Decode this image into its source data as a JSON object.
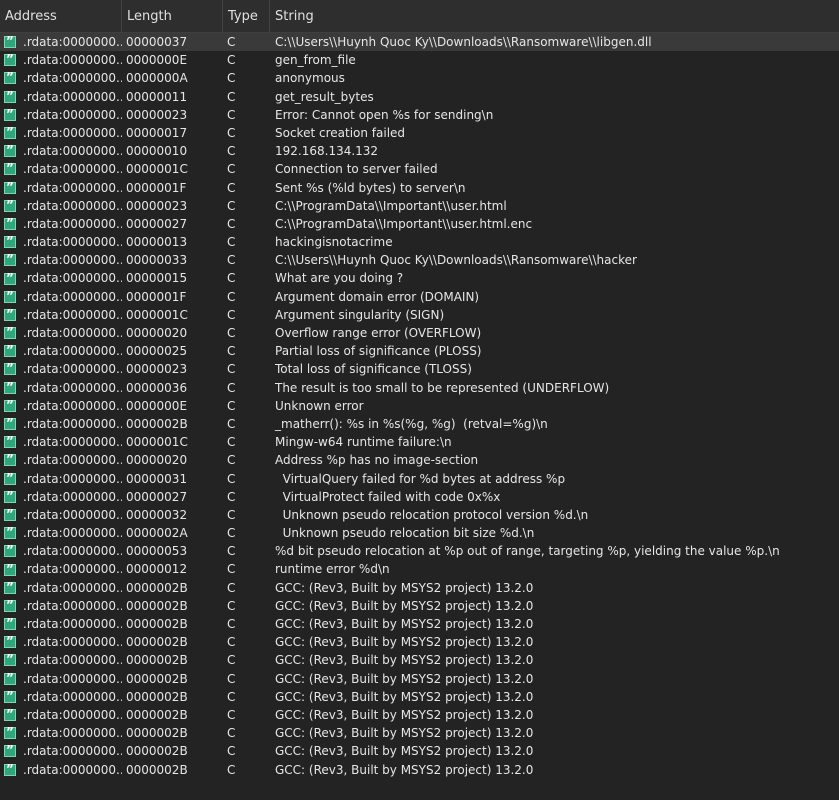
{
  "columns": {
    "address": "Address",
    "length": "Length",
    "type": "Type",
    "string": "String"
  },
  "rows": [
    {
      "address": ".rdata:0000000...",
      "length": "00000037",
      "type": "C",
      "string": "C:\\\\Users\\\\Huynh Quoc Ky\\\\Downloads\\\\Ransomware\\\\libgen.dll"
    },
    {
      "address": ".rdata:0000000...",
      "length": "0000000E",
      "type": "C",
      "string": "gen_from_file"
    },
    {
      "address": ".rdata:0000000...",
      "length": "0000000A",
      "type": "C",
      "string": "anonymous"
    },
    {
      "address": ".rdata:0000000...",
      "length": "00000011",
      "type": "C",
      "string": "get_result_bytes"
    },
    {
      "address": ".rdata:0000000...",
      "length": "00000023",
      "type": "C",
      "string": "Error: Cannot open %s for sending\\n"
    },
    {
      "address": ".rdata:0000000...",
      "length": "00000017",
      "type": "C",
      "string": "Socket creation failed"
    },
    {
      "address": ".rdata:0000000...",
      "length": "00000010",
      "type": "C",
      "string": "192.168.134.132"
    },
    {
      "address": ".rdata:0000000...",
      "length": "0000001C",
      "type": "C",
      "string": "Connection to server failed"
    },
    {
      "address": ".rdata:0000000...",
      "length": "0000001F",
      "type": "C",
      "string": "Sent %s (%ld bytes) to server\\n"
    },
    {
      "address": ".rdata:0000000...",
      "length": "00000023",
      "type": "C",
      "string": "C:\\\\ProgramData\\\\Important\\\\user.html"
    },
    {
      "address": ".rdata:0000000...",
      "length": "00000027",
      "type": "C",
      "string": "C:\\\\ProgramData\\\\Important\\\\user.html.enc"
    },
    {
      "address": ".rdata:0000000...",
      "length": "00000013",
      "type": "C",
      "string": "hackingisnotacrime"
    },
    {
      "address": ".rdata:0000000...",
      "length": "00000033",
      "type": "C",
      "string": "C:\\\\Users\\\\Huynh Quoc Ky\\\\Downloads\\\\Ransomware\\\\hacker"
    },
    {
      "address": ".rdata:0000000...",
      "length": "00000015",
      "type": "C",
      "string": "What are you doing ?"
    },
    {
      "address": ".rdata:0000000...",
      "length": "0000001F",
      "type": "C",
      "string": "Argument domain error (DOMAIN)"
    },
    {
      "address": ".rdata:0000000...",
      "length": "0000001C",
      "type": "C",
      "string": "Argument singularity (SIGN)"
    },
    {
      "address": ".rdata:0000000...",
      "length": "00000020",
      "type": "C",
      "string": "Overflow range error (OVERFLOW)"
    },
    {
      "address": ".rdata:0000000...",
      "length": "00000025",
      "type": "C",
      "string": "Partial loss of significance (PLOSS)"
    },
    {
      "address": ".rdata:0000000...",
      "length": "00000023",
      "type": "C",
      "string": "Total loss of significance (TLOSS)"
    },
    {
      "address": ".rdata:0000000...",
      "length": "00000036",
      "type": "C",
      "string": "The result is too small to be represented (UNDERFLOW)"
    },
    {
      "address": ".rdata:0000000...",
      "length": "0000000E",
      "type": "C",
      "string": "Unknown error"
    },
    {
      "address": ".rdata:0000000...",
      "length": "0000002B",
      "type": "C",
      "string": "_matherr(): %s in %s(%g, %g)  (retval=%g)\\n"
    },
    {
      "address": ".rdata:0000000...",
      "length": "0000001C",
      "type": "C",
      "string": "Mingw-w64 runtime failure:\\n"
    },
    {
      "address": ".rdata:0000000...",
      "length": "00000020",
      "type": "C",
      "string": "Address %p has no image-section"
    },
    {
      "address": ".rdata:0000000...",
      "length": "00000031",
      "type": "C",
      "string": "  VirtualQuery failed for %d bytes at address %p"
    },
    {
      "address": ".rdata:0000000...",
      "length": "00000027",
      "type": "C",
      "string": "  VirtualProtect failed with code 0x%x"
    },
    {
      "address": ".rdata:0000000...",
      "length": "00000032",
      "type": "C",
      "string": "  Unknown pseudo relocation protocol version %d.\\n"
    },
    {
      "address": ".rdata:0000000...",
      "length": "0000002A",
      "type": "C",
      "string": "  Unknown pseudo relocation bit size %d.\\n"
    },
    {
      "address": ".rdata:0000000...",
      "length": "00000053",
      "type": "C",
      "string": "%d bit pseudo relocation at %p out of range, targeting %p, yielding the value %p.\\n"
    },
    {
      "address": ".rdata:0000000...",
      "length": "00000012",
      "type": "C",
      "string": "runtime error %d\\n"
    },
    {
      "address": ".rdata:0000000...",
      "length": "0000002B",
      "type": "C",
      "string": "GCC: (Rev3, Built by MSYS2 project) 13.2.0"
    },
    {
      "address": ".rdata:0000000...",
      "length": "0000002B",
      "type": "C",
      "string": "GCC: (Rev3, Built by MSYS2 project) 13.2.0"
    },
    {
      "address": ".rdata:0000000...",
      "length": "0000002B",
      "type": "C",
      "string": "GCC: (Rev3, Built by MSYS2 project) 13.2.0"
    },
    {
      "address": ".rdata:0000000...",
      "length": "0000002B",
      "type": "C",
      "string": "GCC: (Rev3, Built by MSYS2 project) 13.2.0"
    },
    {
      "address": ".rdata:0000000...",
      "length": "0000002B",
      "type": "C",
      "string": "GCC: (Rev3, Built by MSYS2 project) 13.2.0"
    },
    {
      "address": ".rdata:0000000...",
      "length": "0000002B",
      "type": "C",
      "string": "GCC: (Rev3, Built by MSYS2 project) 13.2.0"
    },
    {
      "address": ".rdata:0000000...",
      "length": "0000002B",
      "type": "C",
      "string": "GCC: (Rev3, Built by MSYS2 project) 13.2.0"
    },
    {
      "address": ".rdata:0000000...",
      "length": "0000002B",
      "type": "C",
      "string": "GCC: (Rev3, Built by MSYS2 project) 13.2.0"
    },
    {
      "address": ".rdata:0000000...",
      "length": "0000002B",
      "type": "C",
      "string": "GCC: (Rev3, Built by MSYS2 project) 13.2.0"
    },
    {
      "address": ".rdata:0000000...",
      "length": "0000002B",
      "type": "C",
      "string": "GCC: (Rev3, Built by MSYS2 project) 13.2.0"
    },
    {
      "address": ".rdata:0000000...",
      "length": "0000002B",
      "type": "C",
      "string": "GCC: (Rev3, Built by MSYS2 project) 13.2.0"
    }
  ],
  "icon": "string-literal-icon",
  "colors": {
    "icon": "#2fa67c",
    "background": "#232323",
    "selected_row": "#3a3a3a"
  }
}
